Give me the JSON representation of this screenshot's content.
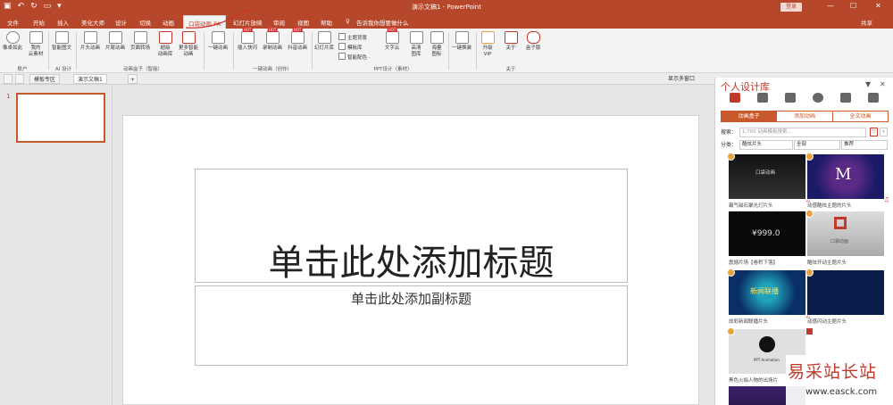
{
  "titlebar": {
    "title": "演示文稿1 - PowerPoint",
    "login": "登录",
    "min": "—",
    "max": "☐",
    "close": "✕"
  },
  "menu": {
    "tabs": [
      "文件",
      "开始",
      "插入",
      "美化大师",
      "设计",
      "切换",
      "动画",
      "口袋动画 PA",
      "幻灯片放映",
      "审阅",
      "视图",
      "帮助"
    ],
    "tell_me": "告诉我你想要做什么",
    "share": "共享"
  },
  "ribbon": {
    "buttons": [
      "像卓如此",
      "我的\n云素材",
      "智能图文",
      "片头动画",
      "片尾动画",
      "页面转场",
      "超级\n动画库",
      "更多智能\n动画",
      "一键动画",
      "插入快闪",
      "录制动画",
      "抖音动画",
      "幻灯片库",
      "文字云",
      "高清\n图库",
      "海量\n图标",
      "一键换装",
      "升级\nVIP",
      "关于",
      "盒子版"
    ],
    "small_items": [
      "主题背景",
      "模板库",
      "智能配色 ·"
    ],
    "groups": [
      "账户",
      "AI 设计",
      "动画盒子（智能）",
      "一键动画（创作）",
      "PPT设计（素材）",
      "关于"
    ],
    "hot": "HOT"
  },
  "tabbar": {
    "tabs": [
      "模板专区",
      "演示文稿1"
    ],
    "add": "+",
    "right_label": "显示多窗口"
  },
  "thumbs": {
    "slide_number": "1"
  },
  "slide": {
    "title_placeholder": "单击此处添加标题",
    "subtitle_placeholder": "单击此处添加副标题"
  },
  "panel": {
    "title": "个人设计库",
    "pin": "▼",
    "close": "✕",
    "tabs": [
      "动画盒子",
      "添加动画",
      "全文动画"
    ],
    "search_label": "搜索：",
    "search_placeholder": "1,705 动画模板搜索...",
    "filter_label": "分类：",
    "filters": [
      "酷炫片头",
      "全部",
      "推荐"
    ],
    "cards": [
      {
        "caption": "霸气磁石聚光灯片头",
        "image_text": "口袋动画"
      },
      {
        "caption": "动感酷炫主题的片头",
        "image_text": "M"
      },
      {
        "caption": "震撼片场【卷积下落】",
        "image_text": "¥999.0"
      },
      {
        "caption": "酷炫开动主题片头",
        "image_text": "口袋动画"
      },
      {
        "caption": "炫彩新闻联播片头",
        "image_text": "新闻联播"
      },
      {
        "caption": "动感闪动主题片头",
        "image_text": ""
      },
      {
        "caption": "黑色火焰人物的出场片",
        "image_text": "PPT Animation"
      },
      {
        "caption": "",
        "image_text": ""
      }
    ]
  },
  "watermark": {
    "line1": "易采站长站",
    "line2": "www.easck.com"
  },
  "colors": {
    "brand": "#b7472a",
    "accent": "#c9582b",
    "badge": "#e8a33b"
  }
}
